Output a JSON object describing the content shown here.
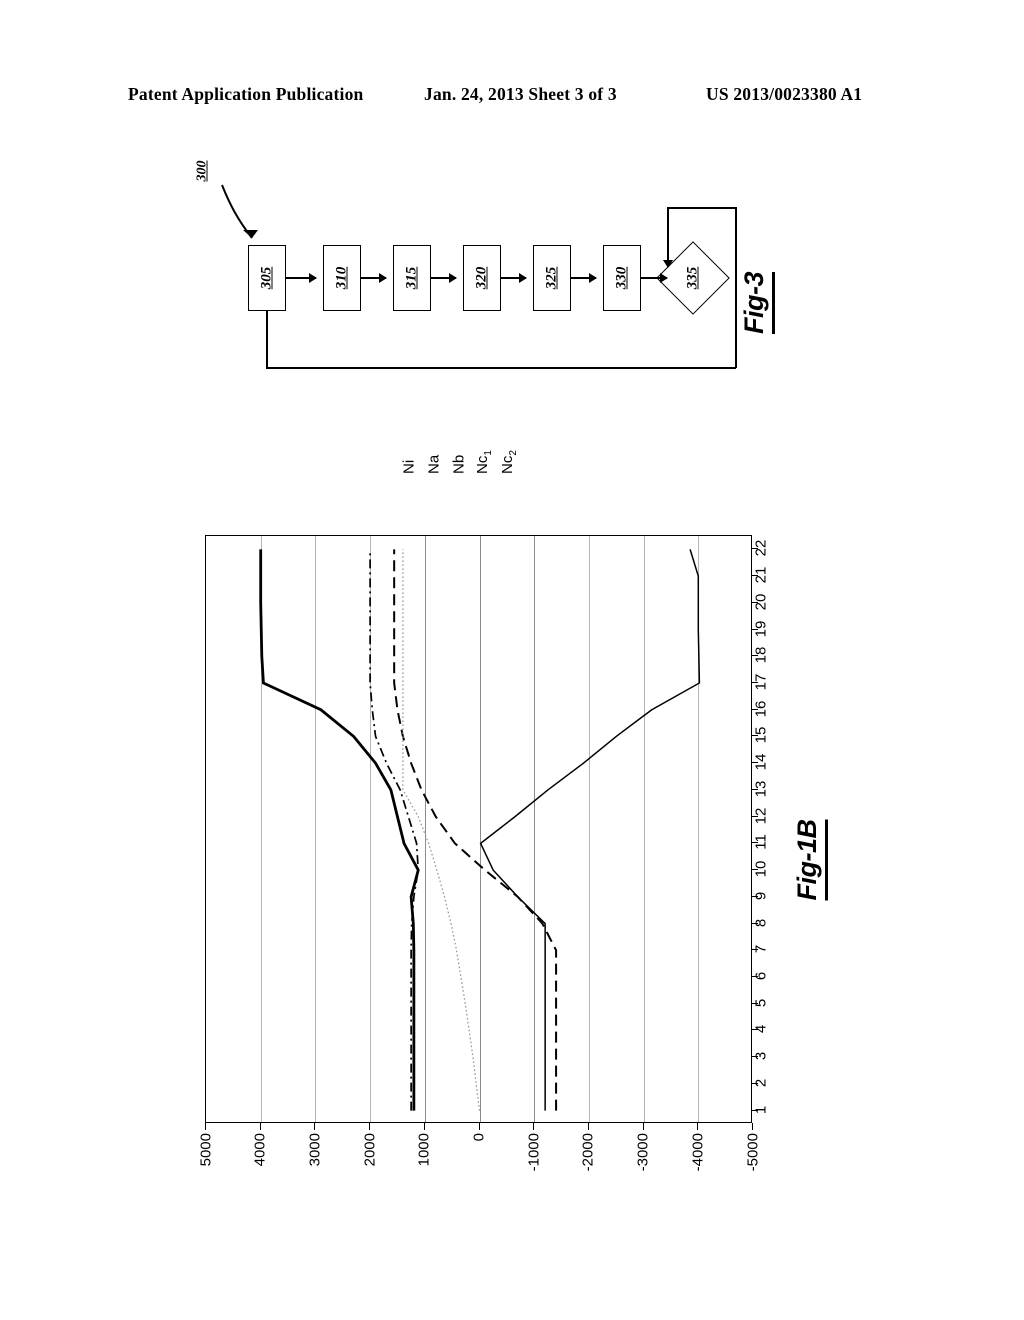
{
  "header": {
    "left": "Patent Application Publication",
    "middle": "Jan. 24, 2013  Sheet 3 of 3",
    "right": "US 2013/0023380 A1"
  },
  "fig3": {
    "caption": "Fig-3",
    "reference_numeral": "300",
    "steps": [
      {
        "id": "305",
        "label": "305",
        "shape": "rect"
      },
      {
        "id": "310",
        "label": "310",
        "shape": "rect"
      },
      {
        "id": "315",
        "label": "315",
        "shape": "rect"
      },
      {
        "id": "320",
        "label": "320",
        "shape": "rect"
      },
      {
        "id": "325",
        "label": "325",
        "shape": "rect"
      },
      {
        "id": "330",
        "label": "330",
        "shape": "rect"
      },
      {
        "id": "335",
        "label": "335",
        "shape": "diamond"
      }
    ]
  },
  "fig1b": {
    "caption": "Fig-1B"
  },
  "chart_data": {
    "type": "line",
    "title": "Fig-1B",
    "orientation": "rotated-90",
    "xlabel": "",
    "ylabel": "",
    "grid": true,
    "legend_position": "top-right",
    "categories": [
      1,
      2,
      3,
      4,
      5,
      6,
      7,
      8,
      9,
      10,
      11,
      12,
      13,
      14,
      15,
      16,
      17,
      18,
      19,
      20,
      21,
      22
    ],
    "value_ticks": [
      5000,
      4000,
      3000,
      2000,
      1000,
      0,
      -1000,
      -2000,
      -3000,
      -4000,
      -5000
    ],
    "ylim": [
      -5000,
      5000
    ],
    "series": [
      {
        "name": "Ni",
        "style": "dash-dot",
        "values": [
          1250,
          1250,
          1250,
          1250,
          1250,
          1250,
          1250,
          1240,
          1200,
          1120,
          1150,
          1300,
          1450,
          1700,
          1900,
          1960,
          2000,
          2000,
          2000,
          2000,
          2000,
          2000
        ]
      },
      {
        "name": "Na",
        "style": "dashed",
        "values": [
          -1400,
          -1400,
          -1400,
          -1400,
          -1400,
          -1400,
          -1400,
          -1150,
          -700,
          -100,
          450,
          800,
          1060,
          1250,
          1400,
          1500,
          1560,
          1560,
          1560,
          1560,
          1560,
          1560
        ]
      },
      {
        "name": "Nb",
        "style": "solid-thick",
        "values": [
          1200,
          1200,
          1200,
          1200,
          1200,
          1200,
          1200,
          1210,
          1250,
          1120,
          1380,
          1500,
          1620,
          1900,
          2300,
          2900,
          3950,
          3980,
          3990,
          4000,
          4000,
          4000
        ]
      },
      {
        "name": "Nc 1",
        "style": "dotted",
        "values": [
          0,
          60,
          120,
          190,
          260,
          340,
          420,
          520,
          640,
          780,
          930,
          1120,
          1400,
          1400,
          1400,
          1400,
          1400,
          1400,
          1400,
          1400,
          1400,
          1400
        ]
      },
      {
        "name": "Nc 2",
        "style": "solid-thin",
        "values": [
          -1200,
          -1200,
          -1200,
          -1200,
          -1200,
          -1200,
          -1200,
          -1200,
          -700,
          -250,
          -20,
          -650,
          -1250,
          -1900,
          -2500,
          -3150,
          -4020,
          -4010,
          -4000,
          -4000,
          -4000,
          -3850
        ]
      }
    ]
  }
}
